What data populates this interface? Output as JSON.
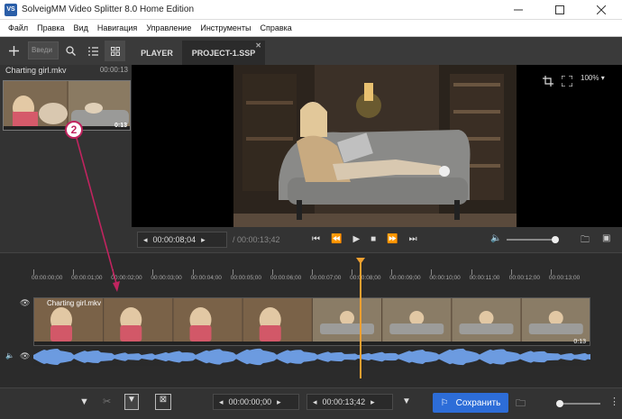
{
  "window": {
    "title": "SolveigMM Video Splitter 8.0 Home Edition",
    "icon_text": "VS"
  },
  "menu": [
    "Файл",
    "Правка",
    "Вид",
    "Навигация",
    "Управление",
    "Инструменты",
    "Справка"
  ],
  "toolbar": {
    "search_placeholder": "Введи"
  },
  "tabs": [
    {
      "label": "PLAYER"
    },
    {
      "label": "PROJECT-1.SSP"
    }
  ],
  "file": {
    "name": "Charting girl.mkv",
    "duration": "00:00:13",
    "thumb_label": "0:13"
  },
  "annotation": {
    "badge": "2"
  },
  "preview": {
    "zoom": "100%"
  },
  "controls": {
    "current_time": "00:00:08;04",
    "total_time": "/ 00:00:13;42"
  },
  "ruler": {
    "ticks": [
      "00:00:00;00",
      "00:00:01;00",
      "00:00:02;00",
      "00:00:03;00",
      "00:00:04;00",
      "00:00:05;00",
      "00:00:06;00",
      "00:00:07;00",
      "00:00:08;00",
      "00:00:09;00",
      "00:00:10;00",
      "00:00:11;00",
      "00:00:12;00",
      "00:00:13;00"
    ],
    "playhead_fraction": 0.585
  },
  "track": {
    "clip_name": "Charting girl.mkv",
    "end_label": "0:13"
  },
  "bottom": {
    "start_time": "00:00:00;00",
    "end_time": "00:00:13;42",
    "save_label": "Сохранить"
  },
  "colors": {
    "accent": "#2d6dd8",
    "playhead": "#f0a030",
    "annotation": "#c0245f",
    "wave": "#6c9be0"
  }
}
